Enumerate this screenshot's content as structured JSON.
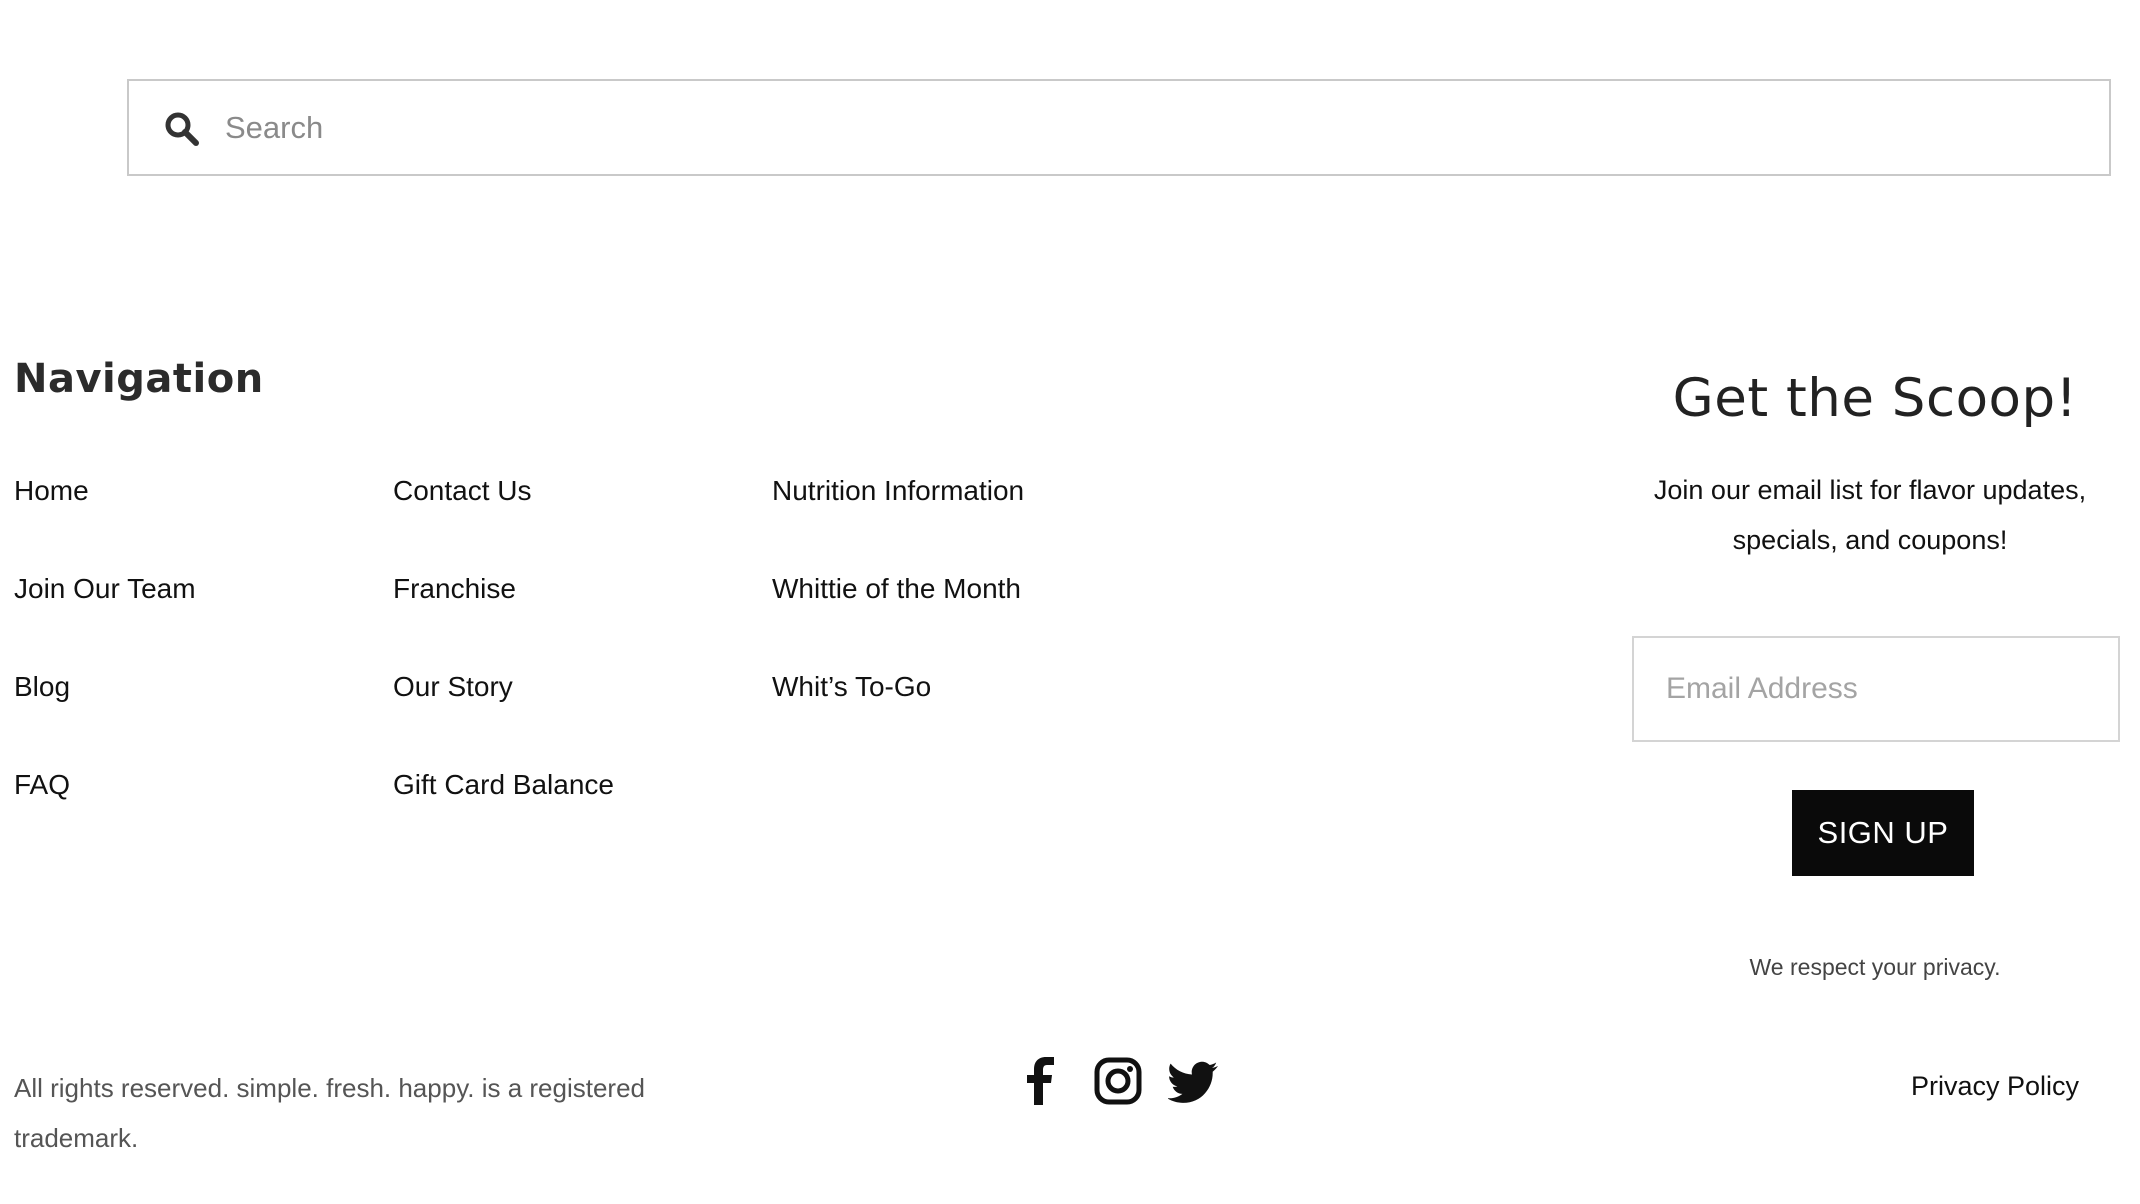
{
  "search": {
    "placeholder": "Search"
  },
  "navigation": {
    "heading": "Navigation",
    "links": [
      [
        "Home",
        "Contact Us",
        "Nutrition Information"
      ],
      [
        "Join Our Team",
        "Franchise",
        "Whittie of the Month"
      ],
      [
        "Blog",
        "Our Story",
        "Whit’s To-Go"
      ],
      [
        "FAQ",
        "Gift Card Balance"
      ]
    ]
  },
  "newsletter": {
    "title": "Get the Scoop!",
    "description": "Join our email list for flavor updates, specials, and coupons!",
    "email_placeholder": "Email Address",
    "button_label": "SIGN UP",
    "privacy_note": "We respect your privacy."
  },
  "footer": {
    "rights_text": "All rights reserved. simple. fresh. happy. is a registered trademark.",
    "social_icons": [
      "facebook-icon",
      "instagram-icon",
      "twitter-icon"
    ],
    "privacy_link": "Privacy Policy"
  },
  "colors": {
    "button_background": "#0a0a0a",
    "button_text": "#ffffff",
    "border": "#c9c9c9"
  }
}
